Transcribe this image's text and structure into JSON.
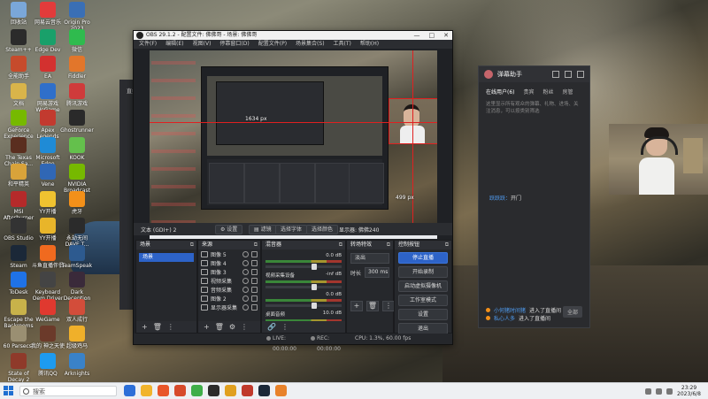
{
  "desktop_icons": [
    {
      "label": "回收站",
      "color": "#7aa7d9"
    },
    {
      "label": "网易云音乐",
      "color": "#e23b3b"
    },
    {
      "label": "Origin Pro 2023",
      "color": "#3a6fb5"
    },
    {
      "label": "Steam++",
      "color": "#2b2b2b"
    },
    {
      "label": "Edge Dev",
      "color": "#19a06a"
    },
    {
      "label": "微信",
      "color": "#2fbb4e"
    },
    {
      "label": "全能助手",
      "color": "#c64b2c"
    },
    {
      "label": "EA",
      "color": "#d3312f"
    },
    {
      "label": "Fiddler",
      "color": "#e2762b"
    },
    {
      "label": "文档",
      "color": "#d9b44a"
    },
    {
      "label": "网易游戏 WeGame",
      "color": "#2f6fca"
    },
    {
      "label": "腾讯游戏",
      "color": "#cf3b3b"
    },
    {
      "label": "GeForce Experience",
      "color": "#76b900"
    },
    {
      "label": "Apex Legends",
      "color": "#c23a2f"
    },
    {
      "label": "Ghostrunner",
      "color": "#2a2a2a"
    },
    {
      "label": "The Texas Chain Sa...",
      "color": "#5a2e1f"
    },
    {
      "label": "Microsoft Edge",
      "color": "#1f8bd6"
    },
    {
      "label": "KOOK",
      "color": "#64c04c"
    },
    {
      "label": "和平精英",
      "color": "#d9a33a"
    },
    {
      "label": "Vene",
      "color": "#3067b5"
    },
    {
      "label": "NVIDIA Broadcast",
      "color": "#76b900"
    },
    {
      "label": "MSI Afterburner",
      "color": "#b52a2a"
    },
    {
      "label": "YY开播",
      "color": "#f0c330"
    },
    {
      "label": "虎牙",
      "color": "#f39019"
    },
    {
      "label": "OBS Studio",
      "color": "#333333"
    },
    {
      "label": "YY开播",
      "color": "#e8b52a"
    },
    {
      "label": "永劫无间 DAVE T...",
      "color": "#2b2b2b"
    },
    {
      "label": "Steam",
      "color": "#1b2838"
    },
    {
      "label": "斗鱼直播伴侣",
      "color": "#f06a1f"
    },
    {
      "label": "TeamSpeak",
      "color": "#2d5a8f"
    },
    {
      "label": "ToDesk",
      "color": "#1f72e6"
    },
    {
      "label": "Keyboard Oem Driver",
      "color": "#444444"
    },
    {
      "label": "Dark Deception",
      "color": "#3a2a3a"
    },
    {
      "label": "Escape the Backrooms",
      "color": "#c8b24a"
    },
    {
      "label": "WeGame",
      "color": "#e0392f"
    },
    {
      "label": "双人成行",
      "color": "#d34d3a"
    },
    {
      "label": "60 Parsecs!",
      "color": "#9a8f72"
    },
    {
      "label": "我的 神之天使",
      "color": "#6b3a2a"
    },
    {
      "label": "超级鸡马",
      "color": "#f0b02a"
    },
    {
      "label": "State of Decay 2",
      "color": "#8f3a2a"
    },
    {
      "label": "腾讯QQ",
      "color": "#1d9bf0"
    },
    {
      "label": "Arknights",
      "color": "#3a82c8"
    }
  ],
  "taskbar": {
    "search_placeholder": "搜索",
    "apps": [
      "#2c6fd8",
      "#f1b42c",
      "#e8562a",
      "#d74a2b",
      "#3fae49",
      "#2b2b2b",
      "#e0a020",
      "#c0392b",
      "#1b2838",
      "#e8822a"
    ],
    "time": "23:29",
    "date": "2023/6/8"
  },
  "danmu": {
    "title": "弹幕助手",
    "tabs": [
      "在线用户(6)",
      "贵宾",
      "粉丝",
      "房管"
    ],
    "desc": "这里显示所有观众的弹幕、礼物、进场、关注消息，可以按类别筛选",
    "msg1_user": "跃跃跃",
    "msg1_text": "开门",
    "footer_user1": "小何猪时间猪",
    "footer_text1": "进入了直播间",
    "footer_user2": "私心人多",
    "footer_text2": "进入了直播间",
    "send_label": "全部",
    "left_label": "直播"
  },
  "obs": {
    "title": "OBS 29.1.2 - 配置文件: 佛佛哥 - 场景: 佛佛哥",
    "menu": [
      "文件(F)",
      "编辑(E)",
      "视图(V)",
      "停靠窗口(D)",
      "配置文件(P)",
      "场景集合(S)",
      "工具(T)",
      "帮助(H)"
    ],
    "preview_px_w": "1634 px",
    "preview_px_h": "499 px",
    "strip_source": "文本 (GDI+) 2",
    "strip_btn_settings": "设置",
    "strip_btn_filters": "滤镜",
    "strip_btn_text": "选择字体",
    "strip_btn_color": "选择颜色",
    "strip_text_label": "显示器: 佛佛240",
    "docks": {
      "scenes": {
        "title": "场景",
        "items": [
          "场景"
        ]
      },
      "sources": {
        "title": "来源",
        "items": [
          "图像 5",
          "图像 4",
          "图像 3",
          "视频采集",
          "音频采集",
          "图像 2",
          "显示器采集"
        ]
      },
      "mixer": {
        "title": "混音器",
        "channels": [
          {
            "name": "",
            "db": "0.0 dB"
          },
          {
            "name": "视频采集设备",
            "db": "-inf dB"
          },
          {
            "name": "",
            "db": "0.0 dB"
          },
          {
            "name": "桌面音频",
            "db": "10.0 dB"
          }
        ]
      },
      "transitions": {
        "title": "转场特效",
        "selected": "淡出",
        "duration_label": "时长",
        "duration_value": "300 ms"
      },
      "controls": {
        "title": "控制按钮",
        "buttons": [
          "停止直播",
          "开始录制",
          "启动虚拟摄像机",
          "工作室模式",
          "设置",
          "退出"
        ]
      }
    },
    "status": {
      "live": "LIVE: 00:00:00",
      "rec": "REC: 00:00:00",
      "cpu": "CPU: 1.3%, 60.00 fps"
    }
  }
}
